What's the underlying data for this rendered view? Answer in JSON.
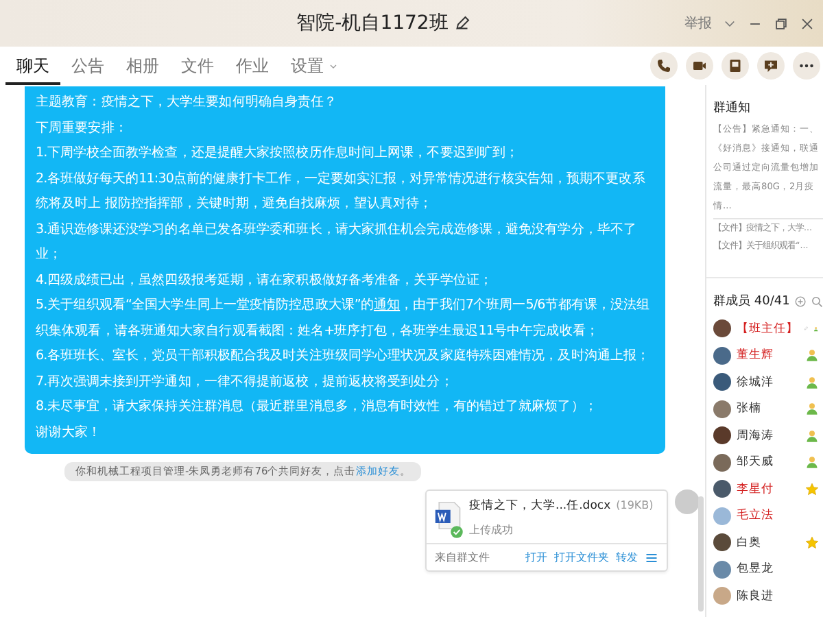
{
  "window": {
    "title": "智院-机自1172班",
    "report": "举报"
  },
  "tabs": [
    {
      "label": "聊天",
      "selected": true
    },
    {
      "label": "公告",
      "selected": false
    },
    {
      "label": "相册",
      "selected": false
    },
    {
      "label": "文件",
      "selected": false
    },
    {
      "label": "作业",
      "selected": false
    },
    {
      "label": "设置",
      "selected": false,
      "dropdown": true
    }
  ],
  "message": {
    "paragraphs": [
      [
        {
          "text": "主题教育：疫情之下，大学生要如何明确自身责任？"
        }
      ],
      [
        {
          "text": "下周重要安排："
        }
      ],
      [
        {
          "text": "1.下周学校全面教学检查，还是提醒大家按照校历作息时间上网课，不要迟到旷到；"
        }
      ],
      [
        {
          "text": "2.各班做好每天的11:30点前的健康打卡工作，一定要如实汇报，对异常情况进行核实告知，预期不更改系统将及时上 报防控指挥部，关键时期，避免自找麻烦，望认真对待；"
        }
      ],
      [
        {
          "text": "3.通识选修课还没学习的名单已发各班学委和班长，请大家抓住机会完成选修课，避免没有学分，毕不了业；"
        }
      ],
      [
        {
          "text": "4.四级成绩已出，虽然四级报考延期，请在家积极做好备考准备，关乎学位证；"
        }
      ],
      [
        {
          "text": "5.关于组织观看“全国大学生同上一堂疫情防控思政大课”的"
        },
        {
          "text": "通知",
          "kind": "link"
        },
        {
          "text": "，由于我们7个班周一5/6节都有课，没法组织集体观看，请各班通知大家自行观看截图：姓名+班序打包，各班学生最迟11号中午完成收看；"
        }
      ],
      [
        {
          "text": "6.各班班长、室长，党员干部积极配合我及时关注班级同学心理状况及家庭特殊困难情况，及时沟通上报；"
        }
      ],
      [
        {
          "text": "7.再次强调未接到开学通知，一律不得提前返校，提前返校将受到处分；"
        }
      ],
      [
        {
          "text": "8.未尽事宜，请大家保持关注群消息（最近群里消息多，消息有时效性，有的错过了就麻烦了）；"
        }
      ],
      [
        {
          "text": "谢谢大家！"
        }
      ]
    ]
  },
  "system_tip": [
    {
      "text": "你和机械工程项目管理-朱凤勇老师有76个共同好友，点击"
    },
    {
      "text": "添加好友",
      "kind": "link"
    },
    {
      "text": "。"
    }
  ],
  "file_card": {
    "name": "疫情之下，大学...任.docx",
    "size": "(19KB)",
    "status": "上传成功",
    "source": "来自群文件",
    "actions": [
      "打开",
      "打开文件夹",
      "转发"
    ]
  },
  "side_panel": {
    "notice_title": "群通知",
    "notice": "【公告】紧急通知：一、《好消息》接通知，联通公司通过定向流量包增加流量，最高80G，2月疫情...",
    "files": [
      "【文件】疫情之下，大学...",
      "【文件】关于组织观看“..."
    ],
    "members_title": "群成员 40/41",
    "members": [
      {
        "name": "【班主任】",
        "color": "#d42020",
        "kind": "person",
        "editable": true
      },
      {
        "name": "董生辉",
        "color": "#d42020",
        "kind": "person"
      },
      {
        "name": "徐城洋",
        "color": "#333333",
        "kind": "person"
      },
      {
        "name": "张楠",
        "color": "#333333",
        "kind": "person"
      },
      {
        "name": "周海涛",
        "color": "#333333",
        "kind": "person"
      },
      {
        "name": "邹天威",
        "color": "#333333",
        "kind": "person"
      },
      {
        "name": "李星付",
        "color": "#d42020",
        "kind": "star"
      },
      {
        "name": "毛立法",
        "color": "#d42020",
        "kind": "plain"
      },
      {
        "name": "白奥",
        "color": "#333333",
        "kind": "star"
      },
      {
        "name": "包昱龙",
        "color": "#333333",
        "kind": "plain"
      },
      {
        "name": "陈良进",
        "color": "#333333",
        "kind": "plain"
      }
    ]
  }
}
